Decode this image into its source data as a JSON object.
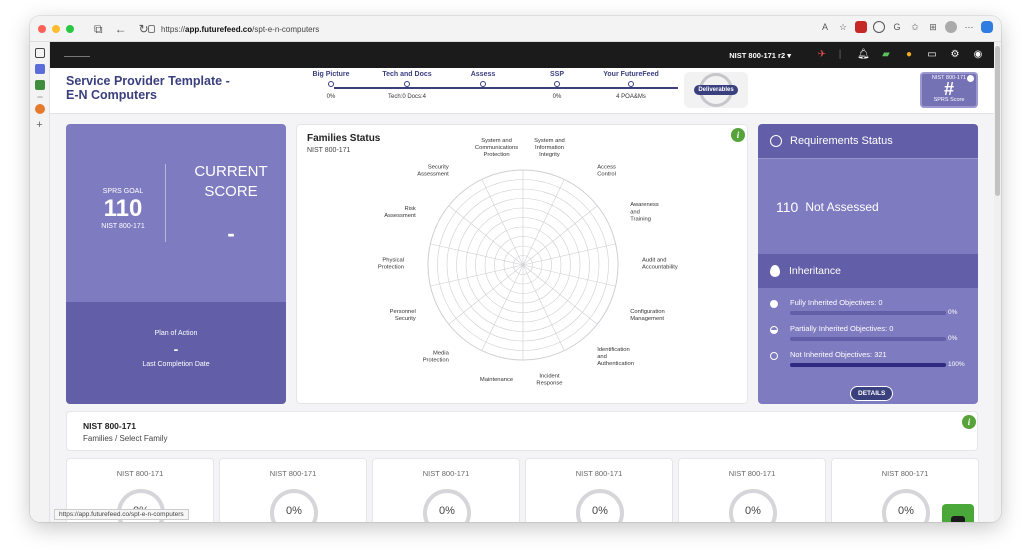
{
  "browser": {
    "url_prefix": "https://",
    "url_host": "app.futurefeed.co",
    "url_path": "/spt-e-n-computers",
    "status_url": "https://app.futurefeed.co/spt-e-n-computers",
    "colors": {
      "close": "#ff5f57",
      "min": "#febc2e",
      "max": "#28c840"
    }
  },
  "topbar": {
    "framework_select": "NIST 800-171 r2",
    "icons": [
      "rocket-icon",
      "bell-icon",
      "chat-icon",
      "bulb-icon",
      "card-icon",
      "gear-icon",
      "user-icon"
    ]
  },
  "header": {
    "title_line1": "Service Provider Template -",
    "title_line2": "E-N Computers",
    "steps": [
      {
        "label": "Big Picture",
        "sub": "0%"
      },
      {
        "label": "Tech and Docs",
        "sub": "Tech:0    Docs:4"
      },
      {
        "label": "Assess",
        "sub": ""
      },
      {
        "label": "SSP",
        "sub": "0%"
      },
      {
        "label": "Your FutureFeed",
        "sub": "4 POA&Ms"
      }
    ],
    "deliverables": "Deliverables",
    "sprs": {
      "top": "NIST 800-171",
      "mark": "#",
      "bottom": "SPRS Score"
    }
  },
  "goal_card": {
    "goal_label": "SPRS GOAL",
    "goal_value": "110",
    "goal_sub": "NIST 800-171",
    "current_label_1": "CURRENT",
    "current_label_2": "SCORE",
    "current_value": "-"
  },
  "poa_card": {
    "title": "Plan of Action",
    "value": "-",
    "date_label": "Last Completion Date"
  },
  "families_status": {
    "title": "Families Status",
    "subtitle": "NIST 800-171",
    "labels": [
      [
        "System and",
        "Information",
        "Integrity"
      ],
      [
        "Access",
        "Control"
      ],
      [
        "Awareness",
        "and",
        "Training"
      ],
      [
        "Audit and",
        "Accountability"
      ],
      [
        "Configuration",
        "Management"
      ],
      [
        "Identification",
        "and",
        "Authentication"
      ],
      [
        "Incident",
        "Response"
      ],
      [
        "Maintenance"
      ],
      [
        "Media",
        "Protection"
      ],
      [
        "Personnel",
        "Security"
      ],
      [
        "Physical",
        "Protection"
      ],
      [
        "Risk",
        "Assessment"
      ],
      [
        "Security",
        "Assessment"
      ],
      [
        "System and",
        "Communications",
        "Protection"
      ]
    ]
  },
  "requirements": {
    "title": "Requirements Status",
    "count": "110",
    "status": "Not Assessed",
    "inheritance_title": "Inheritance",
    "items": [
      {
        "label": "Fully Inherited Objectives: 0",
        "percent": "0%",
        "fill": 0
      },
      {
        "label": "Partially Inherited Objectives: 0",
        "percent": "0%",
        "fill": 0
      },
      {
        "label": "Not Inherited Objectives: 321",
        "percent": "100%",
        "fill": 1
      }
    ],
    "details_button": "DETAILS"
  },
  "families_section": {
    "title": "NIST 800-171",
    "breadcrumb": "Families  /  Select Family"
  },
  "gauges": [
    {
      "title": "NIST 800-171",
      "value": "0%"
    },
    {
      "title": "NIST 800-171",
      "value": "0%"
    },
    {
      "title": "NIST 800-171",
      "value": "0%"
    },
    {
      "title": "NIST 800-171",
      "value": "0%"
    },
    {
      "title": "NIST 800-171",
      "value": "0%"
    },
    {
      "title": "NIST 800-171",
      "value": "0%"
    }
  ]
}
